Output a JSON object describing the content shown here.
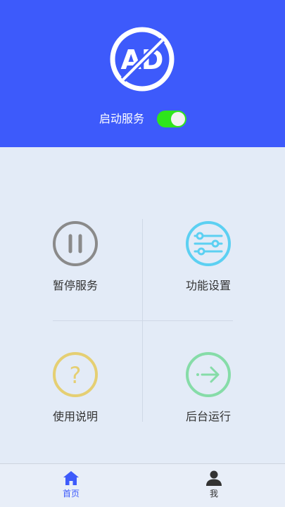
{
  "header": {
    "logo_text": "AD",
    "service_label": "启动服务",
    "service_enabled": true,
    "background_color": "#3d5afb",
    "toggle_color": "#2ee51c"
  },
  "actions": [
    {
      "label": "暂停服务",
      "icon": "pause-icon",
      "color": "#8a8a8a"
    },
    {
      "label": "功能设置",
      "icon": "sliders-icon",
      "color": "#5cd0f2"
    },
    {
      "label": "使用说明",
      "icon": "question-icon",
      "color": "#e5cf73"
    },
    {
      "label": "后台运行",
      "icon": "arrow-right-icon",
      "color": "#86dca8"
    }
  ],
  "tabbar": {
    "tabs": [
      {
        "label": "首页",
        "icon": "home-icon",
        "active": true
      },
      {
        "label": "我",
        "icon": "user-icon",
        "active": false
      }
    ],
    "active_color": "#3d5afb",
    "inactive_color": "#333333"
  }
}
